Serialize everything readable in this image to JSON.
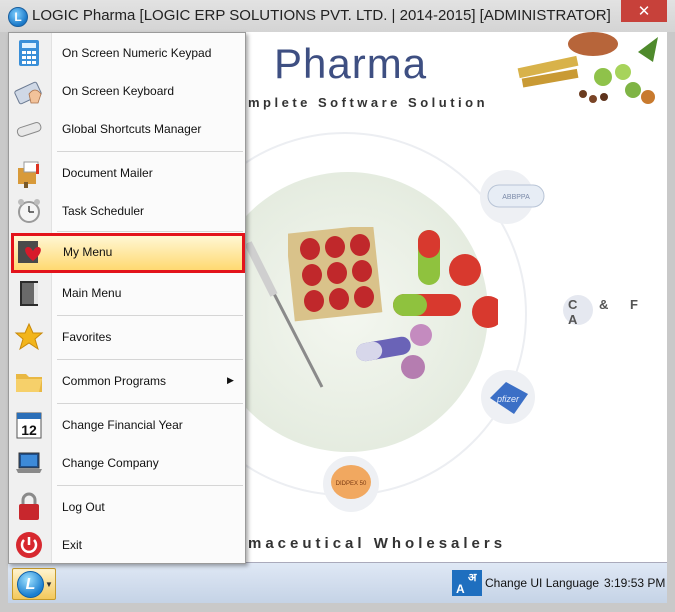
{
  "window": {
    "title": "LOGIC Pharma [LOGIC ERP SOLUTIONS PVT. LTD. | 2014-2015] [ADMINISTRATOR]",
    "close_symbol": "✕"
  },
  "background": {
    "brand": "Pharma",
    "tagline": "mplete Software Solution",
    "subtagline": "maceutical Wholesalers",
    "cfa": "C & F A",
    "pill_label_top": "ABBPPA",
    "pill_label_right": "pfizer",
    "pill_label_bottom": "DIDPEX 50"
  },
  "menu": {
    "items": [
      {
        "label": "On Screen Numeric Keypad",
        "icon": "calculator-icon"
      },
      {
        "label": "On Screen Keyboard",
        "icon": "keyboard-icon"
      },
      {
        "label": "Global Shortcuts Manager",
        "icon": "shortcut-key-icon"
      },
      {
        "label": "Document Mailer",
        "icon": "mailbox-icon"
      },
      {
        "label": "Task Scheduler",
        "icon": "alarm-clock-icon"
      },
      {
        "label": "My Menu",
        "icon": "heart-card-icon"
      },
      {
        "label": "Main Menu",
        "icon": "book-icon"
      },
      {
        "label": "Favorites",
        "icon": "star-icon"
      },
      {
        "label": "Common Programs",
        "icon": "folder-icon"
      },
      {
        "label": "Change Financial Year",
        "icon": "calendar-icon",
        "calendar_day": "12"
      },
      {
        "label": "Change Company",
        "icon": "laptop-icon"
      },
      {
        "label": "Log Out",
        "icon": "lock-icon"
      },
      {
        "label": "Exit",
        "icon": "power-icon"
      }
    ],
    "submenu_arrow": "▶"
  },
  "taskbar": {
    "start_glyph": "L",
    "start_arrow": "▼",
    "lang_icon_text_top": "अ",
    "lang_icon_text_bottom": "A",
    "language_label": "Change UI Language",
    "clock": "3:19:53 PM"
  }
}
